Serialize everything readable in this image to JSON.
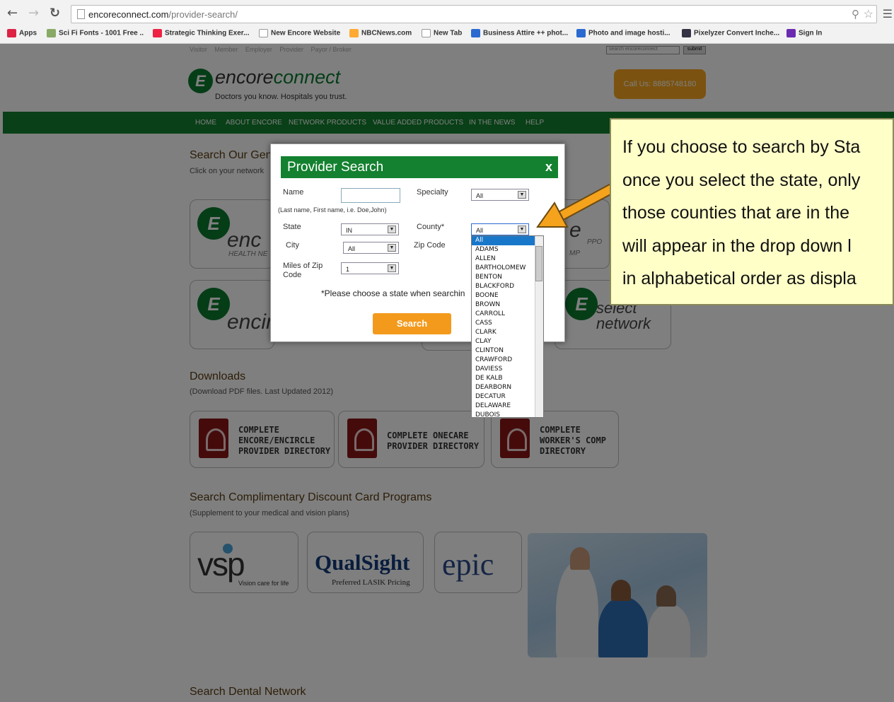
{
  "browser": {
    "url_domain": "encoreconnect.com",
    "url_path": "/provider-search/",
    "bookmarks": [
      {
        "label": "Apps",
        "color": "#d24"
      },
      {
        "label": "Sci Fi Fonts - 1001 Free ..",
        "color": "#8a6"
      },
      {
        "label": "Strategic Thinking Exer...",
        "color": "#e24"
      },
      {
        "label": "New Encore Website",
        "color": "#fff"
      },
      {
        "label": "NBCNews.com",
        "color": "#fa3"
      },
      {
        "label": "New Tab",
        "color": "#fff"
      },
      {
        "label": "Business Attire ++ phot...",
        "color": "#2a6ad0"
      },
      {
        "label": "Photo and image hosti...",
        "color": "#2a6ad0"
      },
      {
        "label": "Pixelyzer Convert Inche...",
        "color": "#334"
      },
      {
        "label": "Sign In",
        "color": "#6a2bb0"
      }
    ]
  },
  "site": {
    "top_links": [
      "Visitor",
      "Member",
      "Employer",
      "Provider",
      "Payor / Broker"
    ],
    "search_placeholder": "search encoreconnect",
    "search_submit": "submit",
    "logo_prefix": "encore",
    "logo_suffix": "connect",
    "logo_letter": "E",
    "tagline": "Doctors you know. Hospitals you trust.",
    "call_us": "Call Us: 8885748180",
    "nav": [
      "HOME",
      "ABOUT ENCORE",
      "NETWORK PRODUCTS",
      "VALUE ADDED PRODUCTS",
      "IN THE NEWS",
      "HELP"
    ],
    "search_general_title": "Search Our Gener",
    "search_general_sub": "Click on your network",
    "networks": {
      "encore_text": "enc",
      "encore_sub": "HEALTH NE",
      "encircle_text": "encir",
      "right_e": "e",
      "right_ppo": "PPO",
      "right_mp": "MP",
      "select_line1": "select",
      "select_line2": "network"
    },
    "downloads_title": "Downloads",
    "downloads_sub": "(Download PDF files. Last Updated 2012)",
    "downloads": [
      {
        "line1": "COMPLETE",
        "line2": "ENCORE/ENCIRCLE",
        "line3": "PROVIDER DIRECTORY"
      },
      {
        "line1": "COMPLETE ONECARE",
        "line2": "PROVIDER DIRECTORY",
        "line3": ""
      },
      {
        "line1": "COMPLETE",
        "line2": "WORKER'S COMP",
        "line3": "DIRECTORY"
      }
    ],
    "discount_title": "Search Complimentary Discount Card Programs",
    "discount_sub": "(Supplement to your medical and vision plans)",
    "vsp_logo": "vsp",
    "vsp_tag": "Vision care for life",
    "qualsight_logo": "QualSight",
    "qualsight_tag": "Preferred LASIK Pricing",
    "epic_logo": "epic",
    "dental_title": "Search Dental Network"
  },
  "modal": {
    "title": "Provider Search",
    "close": "x",
    "name_label": "Name",
    "name_hint": "(Last name, First name, i.e. Doe,John)",
    "specialty_label": "Specialty",
    "specialty_value": "All",
    "state_label": "State",
    "state_value": "IN",
    "county_label": "County*",
    "county_value": "All",
    "city_label": "City",
    "city_value": "All",
    "zip_label": "Zip Code",
    "miles_label": "Miles of Zip Code",
    "miles_value": "1",
    "notice": "*Please choose a state when searchin",
    "search_button": "Search"
  },
  "county_options": [
    "All",
    "ADAMS",
    "ALLEN",
    "BARTHOLOMEW",
    "BENTON",
    "BLACKFORD",
    "BOONE",
    "BROWN",
    "CARROLL",
    "CASS",
    "CLARK",
    "CLAY",
    "CLINTON",
    "CRAWFORD",
    "DAVIESS",
    "DE KALB",
    "DEARBORN",
    "DECATUR",
    "DELAWARE",
    "DUBOIS"
  ],
  "callout": {
    "line1": "If you choose to search by Sta",
    "line2": "once you select the state, only",
    "line3": "those counties that are in the",
    "line4": "will appear in the drop down l",
    "line5": "in alphabetical order as displa"
  },
  "colors": {
    "brand_green": "#13812f",
    "accent_orange": "#f39a1c",
    "callout_bg": "#ffffc8",
    "arrow": "#f5a21c"
  }
}
